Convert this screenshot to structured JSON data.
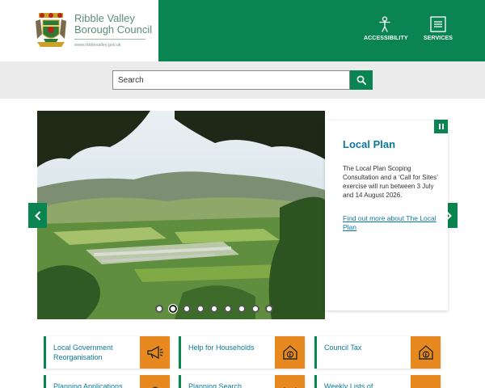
{
  "header": {
    "council_name": "Ribble Valley Borough Council",
    "url": "www.ribblevalley.gov.uk",
    "accessibility_label": "ACCESSIBILITY",
    "services_label": "SERVICES"
  },
  "search": {
    "placeholder": "Search"
  },
  "carousel": {
    "slide_count": 9,
    "active_slide": 2,
    "panel": {
      "title": "Local Plan",
      "text": "The Local Plan Scoping Consultation and a ‘Call for Sites’ exercise will run between 3 July and 14 August 2026.",
      "link": "Find out more about The Local Plan"
    }
  },
  "tiles": [
    {
      "label": "Local Government Reorganisation",
      "icon": "megaphone-icon"
    },
    {
      "label": "Help for Households",
      "icon": "house-pound-icon"
    },
    {
      "label": "Council Tax",
      "icon": "house-pound-icon"
    },
    {
      "label": "Planning Applications",
      "icon": "planning-icon"
    },
    {
      "label": "Planning Search",
      "icon": "search-map-icon"
    },
    {
      "label": "Weekly Lists of",
      "icon": "list-icon"
    }
  ],
  "colors": {
    "brand_green": "#0a8451",
    "tile_orange": "#e8891f",
    "link_blue": "#0a7a9a"
  }
}
